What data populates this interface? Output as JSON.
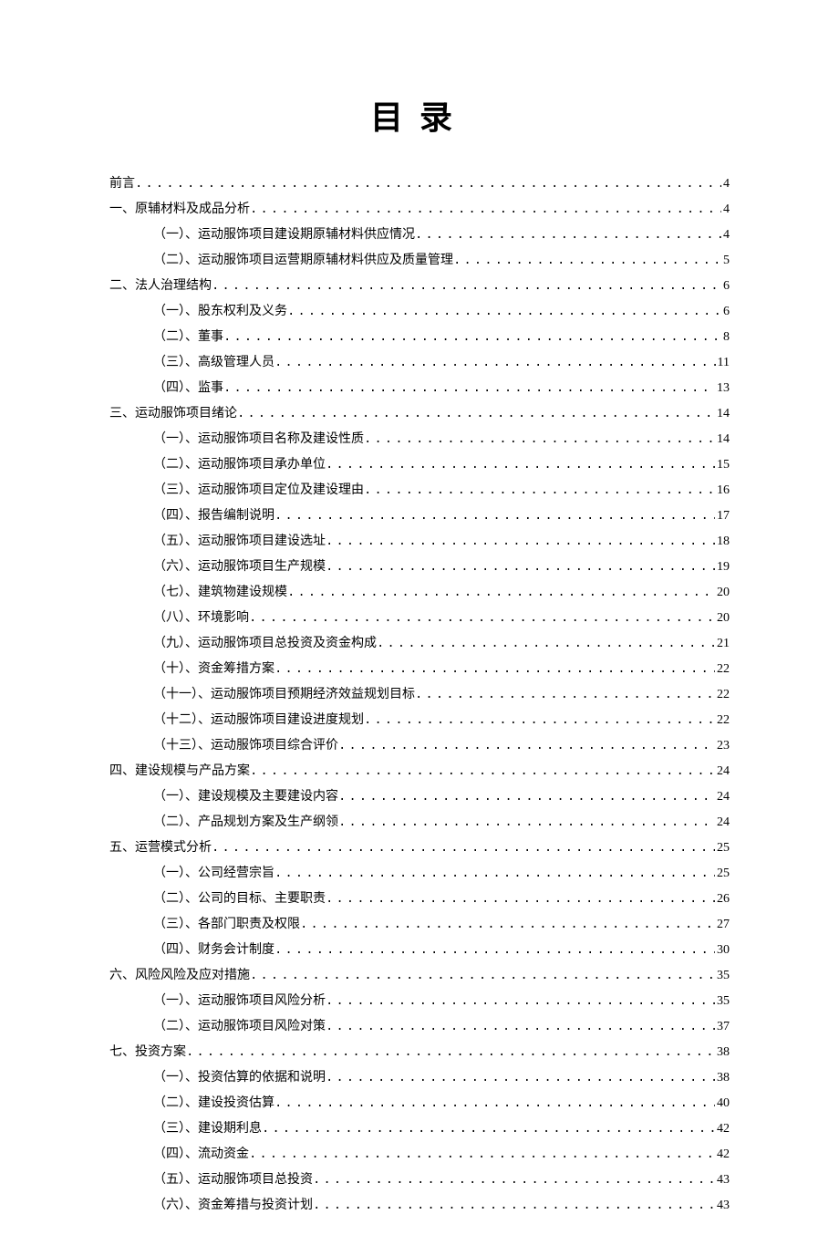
{
  "title": "目录",
  "toc": [
    {
      "level": 0,
      "label": "前言",
      "page": "4"
    },
    {
      "level": 0,
      "label": "一、原辅材料及成品分析",
      "page": "4"
    },
    {
      "level": 1,
      "label": "（一）、运动服饰项目建设期原辅材料供应情况",
      "page": "4"
    },
    {
      "level": 1,
      "label": "（二）、运动服饰项目运营期原辅材料供应及质量管理",
      "page": "5"
    },
    {
      "level": 0,
      "label": "二、法人治理结构",
      "page": "6"
    },
    {
      "level": 1,
      "label": "（一）、股东权利及义务",
      "page": "6"
    },
    {
      "level": 1,
      "label": "（二）、董事",
      "page": "8"
    },
    {
      "level": 1,
      "label": "（三）、高级管理人员",
      "page": "11"
    },
    {
      "level": 1,
      "label": "（四）、监事",
      "page": "13"
    },
    {
      "level": 0,
      "label": "三、运动服饰项目绪论",
      "page": "14"
    },
    {
      "level": 1,
      "label": "（一）、运动服饰项目名称及建设性质",
      "page": "14"
    },
    {
      "level": 1,
      "label": "（二）、运动服饰项目承办单位",
      "page": "15"
    },
    {
      "level": 1,
      "label": "（三）、运动服饰项目定位及建设理由",
      "page": "16"
    },
    {
      "level": 1,
      "label": "（四）、报告编制说明",
      "page": "17"
    },
    {
      "level": 1,
      "label": "（五）、运动服饰项目建设选址",
      "page": "18"
    },
    {
      "level": 1,
      "label": "（六）、运动服饰项目生产规模",
      "page": "19"
    },
    {
      "level": 1,
      "label": "（七）、建筑物建设规模",
      "page": "20"
    },
    {
      "level": 1,
      "label": "（八）、环境影响",
      "page": "20"
    },
    {
      "level": 1,
      "label": "（九）、运动服饰项目总投资及资金构成",
      "page": "21"
    },
    {
      "level": 1,
      "label": "（十）、资金筹措方案",
      "page": "22"
    },
    {
      "level": 1,
      "label": "（十一）、运动服饰项目预期经济效益规划目标",
      "page": "22"
    },
    {
      "level": 1,
      "label": "（十二）、运动服饰项目建设进度规划",
      "page": "22"
    },
    {
      "level": 1,
      "label": "（十三）、运动服饰项目综合评价",
      "page": "23"
    },
    {
      "level": 0,
      "label": "四、建设规模与产品方案",
      "page": "24"
    },
    {
      "level": 1,
      "label": "（一）、建设规模及主要建设内容",
      "page": "24"
    },
    {
      "level": 1,
      "label": "（二）、产品规划方案及生产纲领",
      "page": "24"
    },
    {
      "level": 0,
      "label": "五、运营模式分析",
      "page": "25"
    },
    {
      "level": 1,
      "label": "（一）、公司经营宗旨",
      "page": "25"
    },
    {
      "level": 1,
      "label": "（二）、公司的目标、主要职责",
      "page": "26"
    },
    {
      "level": 1,
      "label": "（三）、各部门职责及权限",
      "page": "27"
    },
    {
      "level": 1,
      "label": "（四）、财务会计制度",
      "page": "30"
    },
    {
      "level": 0,
      "label": "六、风险风险及应对措施",
      "page": "35"
    },
    {
      "level": 1,
      "label": "（一）、运动服饰项目风险分析",
      "page": "35"
    },
    {
      "level": 1,
      "label": "（二）、运动服饰项目风险对策",
      "page": "37"
    },
    {
      "level": 0,
      "label": "七、投资方案",
      "page": "38"
    },
    {
      "level": 1,
      "label": "（一）、投资估算的依据和说明",
      "page": "38"
    },
    {
      "level": 1,
      "label": "（二）、建设投资估算",
      "page": "40"
    },
    {
      "level": 1,
      "label": "（三）、建设期利息",
      "page": "42"
    },
    {
      "level": 1,
      "label": "（四）、流动资金",
      "page": "42"
    },
    {
      "level": 1,
      "label": "（五）、运动服饰项目总投资",
      "page": "43"
    },
    {
      "level": 1,
      "label": "（六）、资金筹措与投资计划",
      "page": "43"
    }
  ]
}
